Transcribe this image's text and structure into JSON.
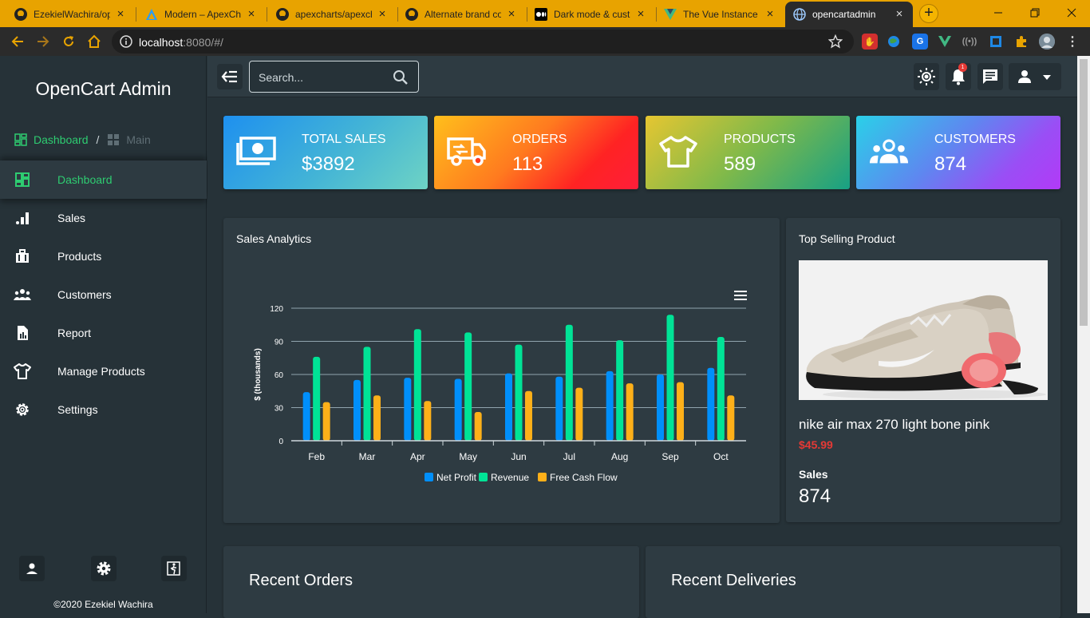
{
  "browser": {
    "tabs": [
      {
        "title": "EzekielWachira/op",
        "favicon": "github-icon"
      },
      {
        "title": "Modern – ApexCh",
        "favicon": "apexcharts-icon"
      },
      {
        "title": "apexcharts/apexch",
        "favicon": "github-icon"
      },
      {
        "title": "Alternate brand co",
        "favicon": "github-icon"
      },
      {
        "title": "Dark mode & cust",
        "favicon": "medium-icon"
      },
      {
        "title": "The Vue Instance",
        "favicon": "vue-icon"
      },
      {
        "title": "opencartadmin",
        "favicon": "globe-icon",
        "active": true
      }
    ],
    "url_host": "localhost",
    "url_rest": ":8080/#/"
  },
  "app": {
    "brand": "OpenCart Admin",
    "breadcrumb": {
      "home": "Dashboard",
      "separator": "/",
      "current": "Main"
    },
    "nav": [
      {
        "label": "Dashboard",
        "icon": "dashboard-icon",
        "active": true
      },
      {
        "label": "Sales",
        "icon": "bar-chart-icon"
      },
      {
        "label": "Products",
        "icon": "briefcase-icon"
      },
      {
        "label": "Customers",
        "icon": "people-icon"
      },
      {
        "label": "Report",
        "icon": "report-icon"
      },
      {
        "label": "Manage Products",
        "icon": "shirt-icon"
      },
      {
        "label": "Settings",
        "icon": "gear-icon"
      }
    ],
    "footer": "©2020 Ezekiel Wachira",
    "search_placeholder": "Search...",
    "notification_count": "1"
  },
  "stats": [
    {
      "label": "TOTAL SALES",
      "value": "$3892",
      "icon": "money-icon"
    },
    {
      "label": "ORDERS",
      "value": "113",
      "icon": "delivery-truck-icon"
    },
    {
      "label": "PRODUCTS",
      "value": "589",
      "icon": "shirt-icon"
    },
    {
      "label": "CUSTOMERS",
      "value": "874",
      "icon": "people-icon"
    }
  ],
  "colors": {
    "accent_green": "#2ecc71",
    "net_profit": "#008ffb",
    "revenue": "#00e396",
    "free_cash_flow": "#feb019",
    "price_red": "#e53935"
  },
  "sales_analytics": {
    "title": "Sales Analytics"
  },
  "chart_data": {
    "type": "bar",
    "title": "",
    "xlabel": "",
    "ylabel": "$ (thousands)",
    "categories": [
      "Feb",
      "Mar",
      "Apr",
      "May",
      "Jun",
      "Jul",
      "Aug",
      "Sep",
      "Oct"
    ],
    "series": [
      {
        "name": "Net Profit",
        "values": [
          44,
          55,
          57,
          56,
          61,
          58,
          63,
          60,
          66
        ]
      },
      {
        "name": "Revenue",
        "values": [
          76,
          85,
          101,
          98,
          87,
          105,
          91,
          114,
          94
        ]
      },
      {
        "name": "Free Cash Flow",
        "values": [
          35,
          41,
          36,
          26,
          45,
          48,
          52,
          53,
          41
        ]
      }
    ],
    "yticks": [
      0,
      30,
      60,
      90,
      120
    ],
    "ylim": [
      0,
      120
    ],
    "grid": true,
    "legend": "bottom"
  },
  "top_selling": {
    "title": "Top Selling Product",
    "product_name": "nike air max 270 light bone pink",
    "price": "$45.99",
    "sales_label": "Sales",
    "sales_value": "874"
  },
  "recent_orders": {
    "title": "Recent Orders"
  },
  "recent_deliveries": {
    "title": "Recent Deliveries"
  }
}
